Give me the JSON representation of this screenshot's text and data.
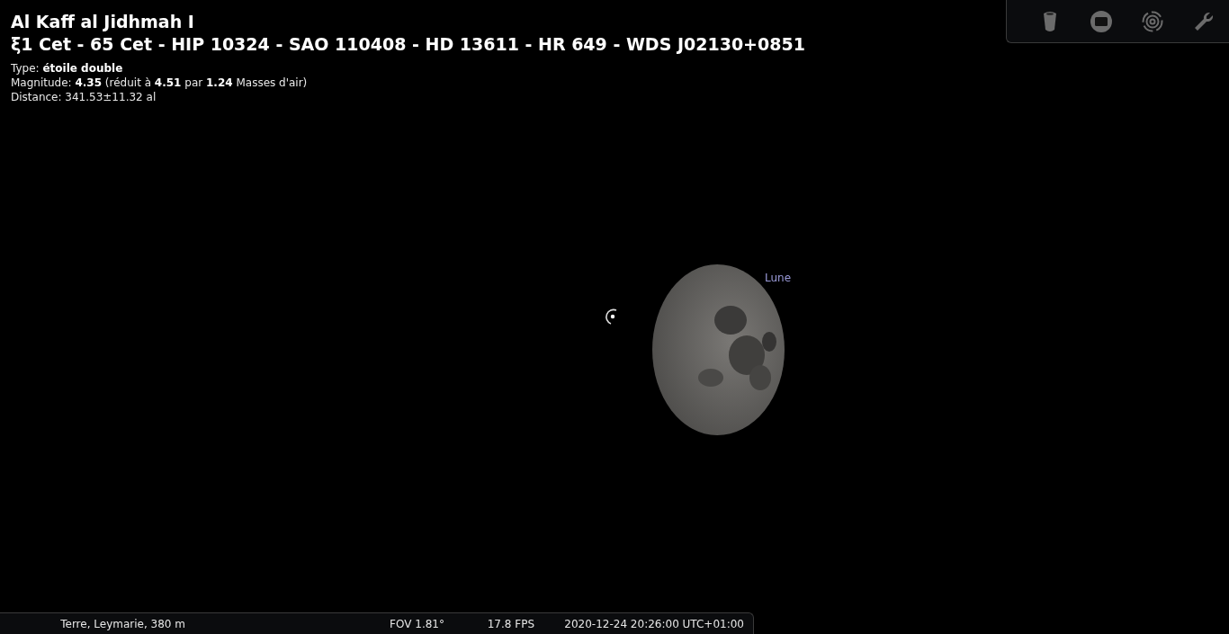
{
  "object_info": {
    "name": "Al Kaff al Jidhmah I",
    "designations": "ξ1 Cet - 65 Cet - HIP 10324 - SAO 110408 - HD 13611 - HR 649 - WDS J02130+0851",
    "details": [
      "Type: **étoile double**",
      "Magnitude: **4.35** (réduit à **4.51** par **1.24** Masses d'air)",
      "Distance: 341.53±11.32 al"
    ]
  },
  "sky": {
    "moon_label": "Lune"
  },
  "status_bar": {
    "location": "Terre, Leymarie, 380 m",
    "fov": "FOV 1.81°",
    "fps": "17.8 FPS",
    "datetime": "2020-12-24 20:26:00 UTC+01:00"
  }
}
